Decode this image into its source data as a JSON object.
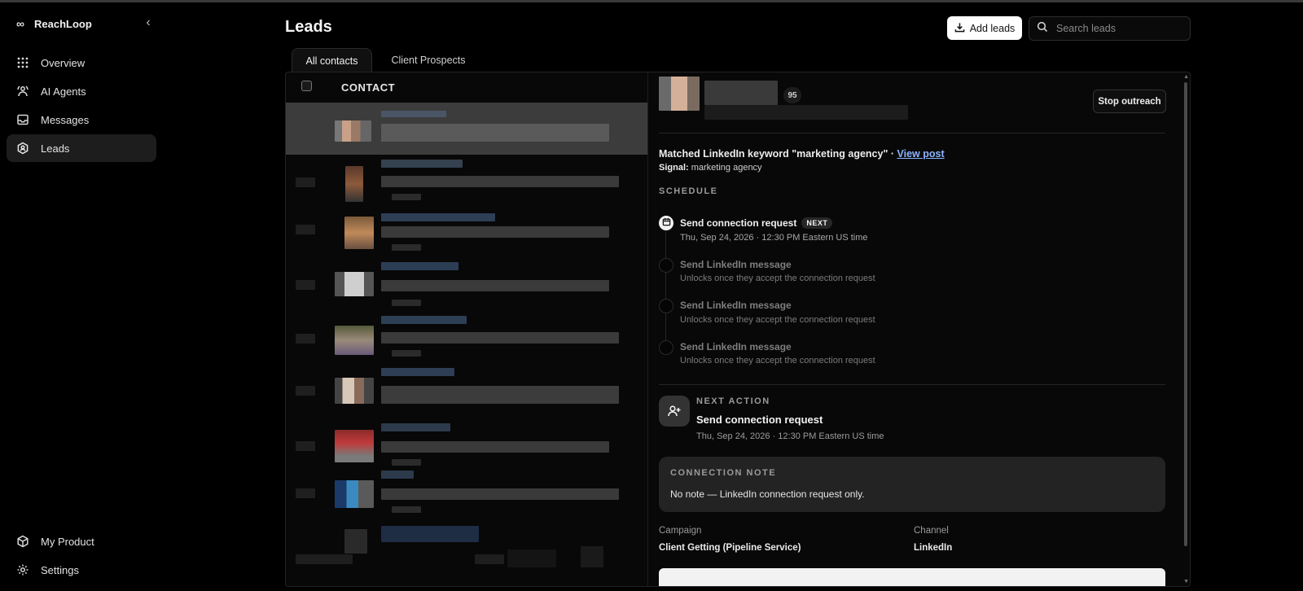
{
  "app": {
    "name": "ReachLoop"
  },
  "sidebar": {
    "items": [
      {
        "label": "Overview",
        "icon": "grid-icon"
      },
      {
        "label": "AI Agents",
        "icon": "agents-icon"
      },
      {
        "label": "Messages",
        "icon": "inbox-icon"
      },
      {
        "label": "Leads",
        "icon": "leads-icon",
        "active": true
      }
    ],
    "bottom_items": [
      {
        "label": "My Product",
        "icon": "cube-icon"
      },
      {
        "label": "Settings",
        "icon": "gear-icon"
      }
    ]
  },
  "header": {
    "title": "Leads",
    "add_leads_label": "Add leads",
    "search_placeholder": "Search leads"
  },
  "tabs": [
    {
      "label": "All contacts",
      "active": true
    },
    {
      "label": "Client Prospects",
      "active": false
    }
  ],
  "list": {
    "column_header": "CONTACT"
  },
  "detail": {
    "score": "95",
    "stop_outreach_label": "Stop outreach",
    "match_text": "Matched LinkedIn keyword \"marketing agency\" · ",
    "match_link": "View post",
    "signal_label": "Signal:",
    "signal_value": "marketing agency",
    "schedule_heading": "SCHEDULE",
    "schedule": [
      {
        "title": "Send connection request",
        "badge": "NEXT",
        "sub": "Thu, Sep 24, 2026 · 12:30 PM Eastern US time"
      },
      {
        "title": "Send LinkedIn message",
        "sub": "Unlocks once they accept the connection request"
      },
      {
        "title": "Send LinkedIn message",
        "sub": "Unlocks once they accept the connection request"
      },
      {
        "title": "Send LinkedIn message",
        "sub": "Unlocks once they accept the connection request"
      }
    ],
    "next_action": {
      "label": "NEXT ACTION",
      "title": "Send connection request",
      "time": "Thu, Sep 24, 2026 · 12:30 PM Eastern US time"
    },
    "connection_note": {
      "label": "CONNECTION NOTE",
      "text": "No note — LinkedIn connection request only."
    },
    "campaign_label": "Campaign",
    "campaign_value": "Client Getting (Pipeline Service)",
    "channel_label": "Channel",
    "channel_value": "LinkedIn"
  },
  "colors": {
    "background": "#000000",
    "accent_link": "#8db4ff",
    "button_primary": "#ffffff"
  }
}
